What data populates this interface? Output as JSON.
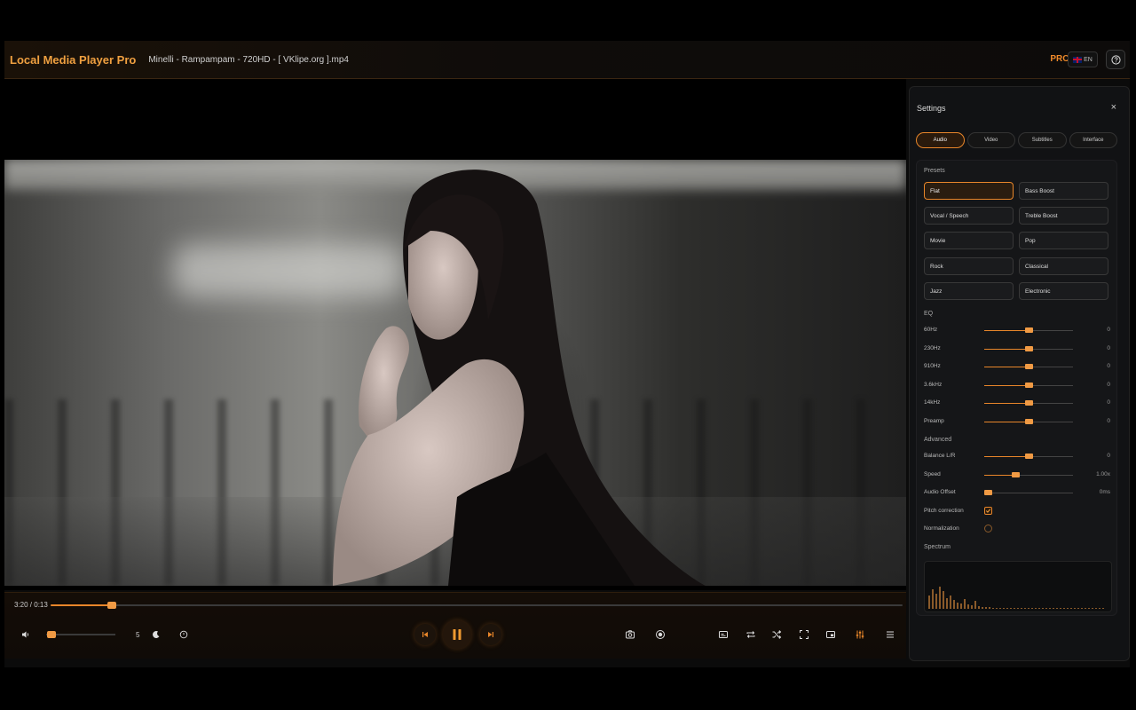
{
  "app": {
    "title": "Local Media Player Pro",
    "file_name": "Minelli - Rampampam - 720HD - [ VKlipe.org ].mp4",
    "pro_badge": "PRO",
    "language": "EN"
  },
  "colors": {
    "accent": "#e8862a",
    "title": "#f0a040",
    "background": "#0b0b0b"
  },
  "player": {
    "time_label": "3:20 / 0:13",
    "seek_progress": 0.072,
    "volume_value": "5",
    "volume_level": 0.05,
    "is_playing": true
  },
  "controls": {
    "left": [
      "volume-icon",
      "sleep-moon-icon",
      "timer-icon"
    ],
    "center": [
      "previous-icon",
      "pause-icon",
      "next-icon"
    ],
    "right": [
      "snapshot-icon",
      "record-icon",
      "subtitles-icon",
      "repeat-icon",
      "shuffle-icon",
      "fullscreen-icon",
      "picture-in-picture-icon",
      "equalizer-icon",
      "menu-icon"
    ]
  },
  "settings": {
    "title": "Settings",
    "close": "×",
    "tabs": [
      {
        "label": "Audio",
        "active": true
      },
      {
        "label": "Video",
        "active": false
      },
      {
        "label": "Subtitles",
        "active": false
      },
      {
        "label": "Interface",
        "active": false
      }
    ],
    "presets_label": "Presets",
    "presets": [
      {
        "label": "Flat",
        "active": true
      },
      {
        "label": "Bass Boost",
        "active": false
      },
      {
        "label": "Vocal / Speech",
        "active": false
      },
      {
        "label": "Treble Boost",
        "active": false
      },
      {
        "label": "Movie",
        "active": false
      },
      {
        "label": "Pop",
        "active": false
      },
      {
        "label": "Rock",
        "active": false
      },
      {
        "label": "Classical",
        "active": false
      },
      {
        "label": "Jazz",
        "active": false
      },
      {
        "label": "Electronic",
        "active": false
      }
    ],
    "eq_label": "EQ",
    "eq": [
      {
        "label": "60Hz",
        "value": "0",
        "level": 0.5
      },
      {
        "label": "230Hz",
        "value": "0",
        "level": 0.5
      },
      {
        "label": "910Hz",
        "value": "0",
        "level": 0.5
      },
      {
        "label": "3.6kHz",
        "value": "0",
        "level": 0.5
      },
      {
        "label": "14kHz",
        "value": "0",
        "level": 0.5
      },
      {
        "label": "Preamp",
        "value": "0",
        "level": 0.5
      }
    ],
    "advanced_label": "Advanced",
    "advanced": [
      {
        "label": "Balance L/R",
        "value": "0",
        "level": 0.5
      },
      {
        "label": "Speed",
        "value": "1.00x",
        "level": 0.35
      },
      {
        "label": "Audio Offset",
        "value": "0ms",
        "level": 0.04
      }
    ],
    "pitch_correction": {
      "label": "Pitch correction",
      "checked": true
    },
    "normalization": {
      "label": "Normalization",
      "checked": false
    },
    "spectrum_label": "Spectrum",
    "spectrum_levels": [
      0.3,
      0.45,
      0.35,
      0.5,
      0.4,
      0.25,
      0.3,
      0.2,
      0.15,
      0.12,
      0.22,
      0.1,
      0.08,
      0.18,
      0.06,
      0.05,
      0.04,
      0.04,
      0.03,
      0.03,
      0.03,
      0.03,
      0.03,
      0.03,
      0.03,
      0.03,
      0.03,
      0.03,
      0.03,
      0.03,
      0.03,
      0.03,
      0.03,
      0.03,
      0.03,
      0.03,
      0.03,
      0.03,
      0.03,
      0.03,
      0.03,
      0.03,
      0.03,
      0.03,
      0.03,
      0.03,
      0.03,
      0.03,
      0.03,
      0.03
    ]
  }
}
